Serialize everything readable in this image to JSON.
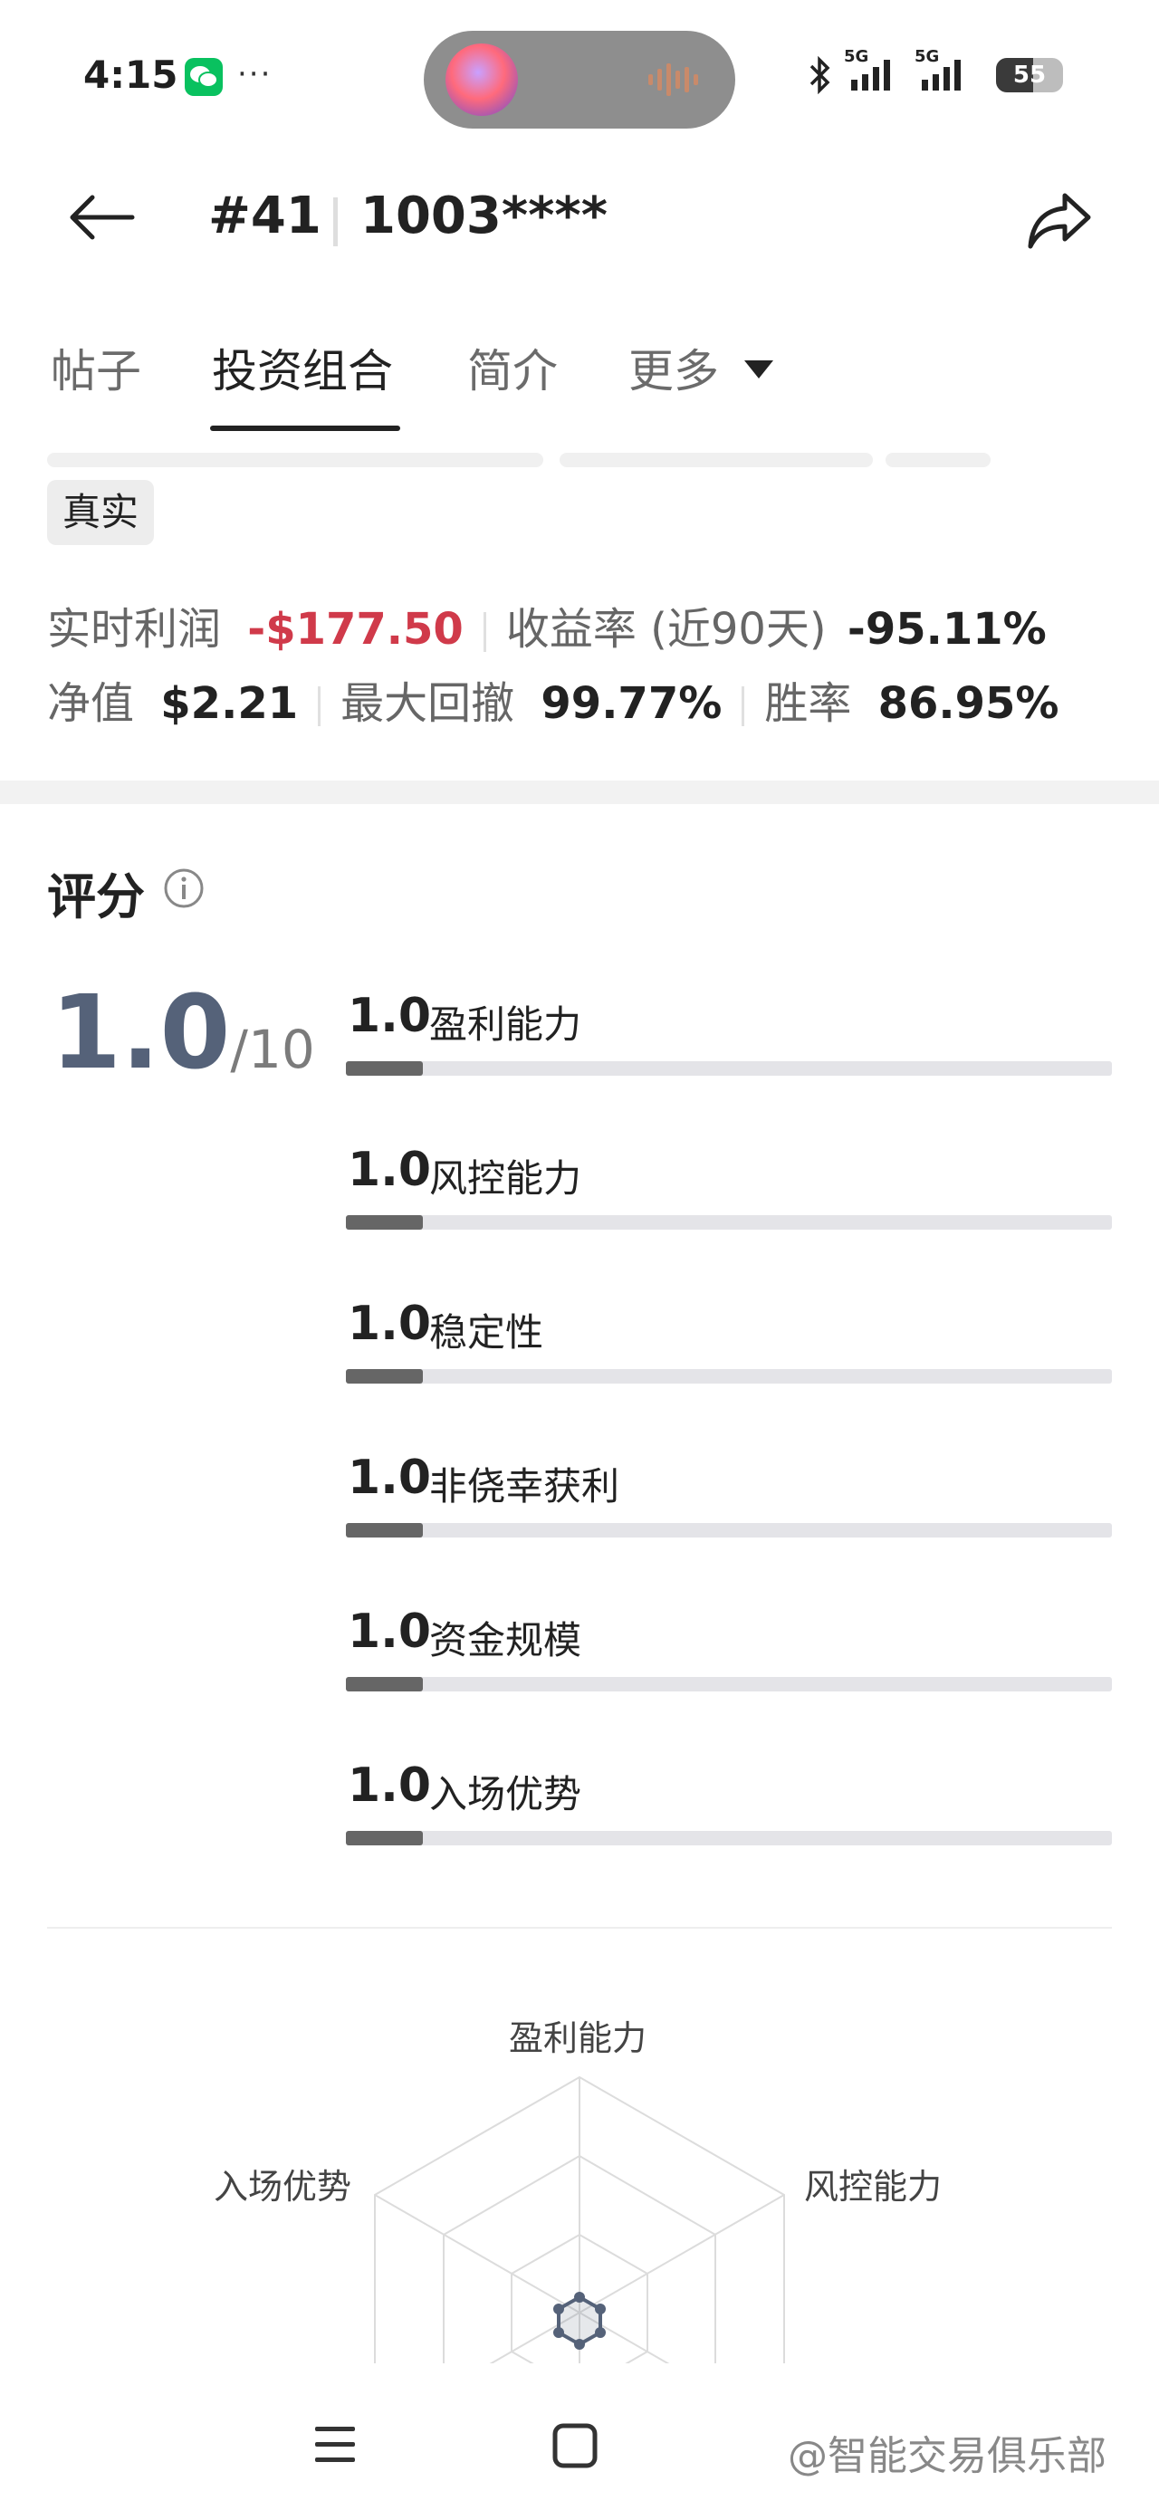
{
  "status_bar": {
    "time": "4:15",
    "network_1": "5G",
    "network_2": "5G",
    "battery": "55"
  },
  "header": {
    "rank": "#41",
    "account_id": "1003****"
  },
  "tabs": [
    {
      "label": "帖子"
    },
    {
      "label": "投资组合"
    },
    {
      "label": "简介"
    },
    {
      "label": "更多"
    }
  ],
  "badge": "真实",
  "metrics": {
    "realtime_profit_label": "实时利润",
    "realtime_profit_value": "-$177.50",
    "return_label": "收益率 (近90天)",
    "return_value": "-95.11%",
    "nav_label": "净值",
    "nav_value": "$2.21",
    "drawdown_label": "最大回撤",
    "drawdown_value": "99.77%",
    "winrate_label": "胜率",
    "winrate_value": "86.95%"
  },
  "score": {
    "title": "评分",
    "overall": "1.0",
    "max": "/10",
    "items": [
      {
        "value": "1.0",
        "label": "盈利能力",
        "fraction": 0.1
      },
      {
        "value": "1.0",
        "label": "风控能力",
        "fraction": 0.1
      },
      {
        "value": "1.0",
        "label": "稳定性",
        "fraction": 0.1
      },
      {
        "value": "1.0",
        "label": "非侥幸获利",
        "fraction": 0.1
      },
      {
        "value": "1.0",
        "label": "资金规模",
        "fraction": 0.1
      },
      {
        "value": "1.0",
        "label": "入场优势",
        "fraction": 0.1
      }
    ]
  },
  "radar": {
    "labels": [
      "盈利能力",
      "风控能力",
      "入场优势"
    ]
  },
  "watermark": "@智能交易俱乐部",
  "colors": {
    "negative": "#d03a4a",
    "score_accent": "#556279",
    "bar_fill": "#666666",
    "bar_track": "#e4e4e8"
  }
}
